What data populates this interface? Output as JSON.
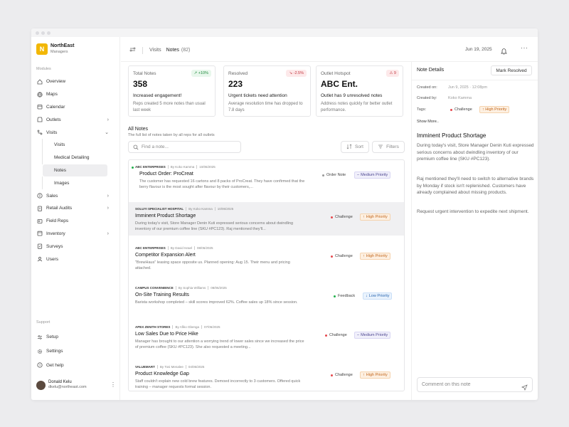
{
  "brand": {
    "name": "NorthEast",
    "sub": "Managers",
    "logo_letter": "N",
    "color": "#f2b705"
  },
  "sidebar": {
    "modules_label": "Modules",
    "items": [
      {
        "label": "Overview",
        "icon": "home-icon"
      },
      {
        "label": "Maps",
        "icon": "globe-icon"
      },
      {
        "label": "Calendar",
        "icon": "calendar-icon"
      },
      {
        "label": "Outlets",
        "icon": "store-icon",
        "chevron": "›"
      },
      {
        "label": "Visits",
        "icon": "route-icon",
        "chevron": "⌄"
      }
    ],
    "visits_sub": [
      {
        "label": "Visits"
      },
      {
        "label": "Medical Detailing"
      },
      {
        "label": "Notes",
        "active": true
      },
      {
        "label": "Images"
      }
    ],
    "items_after": [
      {
        "label": "Sales",
        "icon": "tag-icon",
        "chevron": "›"
      },
      {
        "label": "Retail Audits",
        "icon": "clipboard-icon",
        "chevron": "›"
      },
      {
        "label": "Field Reps",
        "icon": "users-icon"
      },
      {
        "label": "Inventory",
        "icon": "box-icon",
        "chevron": "›"
      },
      {
        "label": "Surveys",
        "icon": "survey-icon"
      },
      {
        "label": "Users",
        "icon": "user-icon"
      }
    ],
    "support_label": "Support",
    "support_items": [
      {
        "label": "Setup",
        "icon": "sliders-icon"
      },
      {
        "label": "Settings",
        "icon": "gear-icon"
      },
      {
        "label": "Get help",
        "icon": "help-icon"
      }
    ],
    "user": {
      "name": "Donald Kelu",
      "email": "dkelu@northeast.com"
    }
  },
  "topbar": {
    "crumb_parent": "Visits",
    "crumb_current": "Notes",
    "crumb_count": "(82)",
    "date": "Jun 19, 2025"
  },
  "stats": [
    {
      "label": "Total Notes",
      "badge": "↗ +10%",
      "value": "358",
      "headline": "Increased engagement!",
      "desc": "Reps created 5 more notes than usual last week",
      "badge_bg": "#e8f7ec",
      "badge_color": "#1f8a3c"
    },
    {
      "label": "Resolved",
      "badge": "↘ -2.5%",
      "value": "223",
      "headline": "Urgent tickets need attention",
      "desc": "Average resolution time has dropped to 7.8 days",
      "badge_bg": "#fde9ea",
      "badge_color": "#c2343d"
    },
    {
      "label": "Outlet Hotspot",
      "badge": "⚠ 9",
      "value": "ABC Ent.",
      "headline": "Outlet has 9 unresolved notes",
      "desc": "Address notes quickly for better outlet performance.",
      "badge_bg": "#fde9ea",
      "badge_color": "#c2343d"
    }
  ],
  "notes_section": {
    "title": "All Notes",
    "subtitle": "The full list of notes taken by all reps for all outlets",
    "search_placeholder": "Find a note...",
    "sort_label": "Sort",
    "filters_label": "Filters"
  },
  "notes": [
    {
      "org": "ABC ENTERPRISES",
      "by": "By Koko Kamma",
      "date": "10/06/2025",
      "title": "Product Order: ProCreat",
      "body": "The customer has requested 16 cartons and 8 packs of ProCreat. They have confirmed that the berry flavour is the most sought after flavour by their customers,...",
      "category": "Order Note",
      "cat_color": "#999999",
      "priority": "Medium Priority",
      "prio_icon": "–",
      "prio_level": "med",
      "unread": true
    },
    {
      "org": "SOLUYI SPECIALIST HOSPITAL",
      "by": "By Koko Kamma",
      "date": "10/06/2025",
      "title": "Imminent Product Shortage",
      "body": "During today's visit, Store Manager Denin Kuti expressed serious concerns about dwindling inventory of our premium coffee line (SKU #PC123). Raj mentioned they'll...",
      "category": "Challenge",
      "cat_color": "#e5484d",
      "priority": "High Priority",
      "prio_icon": "↑",
      "prio_level": "high",
      "selected": true
    },
    {
      "org": "ABC ENTERPRISES",
      "by": "By David Israel",
      "date": "08/06/2025",
      "title": "Competitor Expansion Alert",
      "body": "\"BrewHaus\" leasing space opposite us. Planned opening: Aug 15. Their menu and pricing attached.",
      "category": "Challenge",
      "cat_color": "#e5484d",
      "priority": "High Priority",
      "prio_icon": "↑",
      "prio_level": "high"
    },
    {
      "org": "CAMPUS CONVENIENCE",
      "by": "By Sophia Williams",
      "date": "08/06/2025",
      "title": "On-Site Training Results",
      "body": "Barista workshop completed – skill scores improved 62%. Coffee sales up 18% since session.",
      "category": "Feedback",
      "cat_color": "#22b14c",
      "priority": "Low Priority",
      "prio_icon": "↓",
      "prio_level": "low"
    },
    {
      "org": "APEX ZENITH STORES",
      "by": "By Afiko Gbenga",
      "date": "07/06/2025",
      "title": "Low Sales Due to Price Hike",
      "body": "Manager has brought to our attention a worrying trend of lower sales since we increased the price of premium coffee (SKU #PC123). She also requested a meeting...",
      "category": "Challenge",
      "cat_color": "#e5484d",
      "priority": "Medium Priority",
      "prio_icon": "–",
      "prio_level": "med"
    },
    {
      "org": "VALUEMART",
      "by": "By Tosi Menalee",
      "date": "04/06/2025",
      "title": "Product Knowledge Gap",
      "body": "Staff couldn't explain new cold brew features. Demoed incorrectly to 3 customers. Offered quick training – manager requests formal session.",
      "category": "Challenge",
      "cat_color": "#e5484d",
      "priority": "High Priority",
      "prio_icon": "↑",
      "prio_level": "high"
    }
  ],
  "detail": {
    "header": "Note Details",
    "mark_resolved": "Mark Resolved",
    "created_on_label": "Created on:",
    "created_on": "Jun 9, 2025 · 12:08pm",
    "created_by_label": "Created by:",
    "created_by": "Koko Kamma",
    "tags_label": "Tags:",
    "tag1": "Challenge",
    "tag2": "↑ High Priority",
    "show_more": "Show More..",
    "title": "Imminent Product Shortage",
    "paragraphs": [
      "During today's visit, Store Manager Denin Kuti expressed serious concerns about dwindling inventory of our premium coffee line (SKU #PC123).",
      "Raj mentioned they'll need to switch to alternative brands by Monday if stock isn't replenished. Customers have already complained about missing products.",
      "Request urgent intervention to expedite next shipment."
    ],
    "comment_placeholder": "Comment on this note"
  }
}
